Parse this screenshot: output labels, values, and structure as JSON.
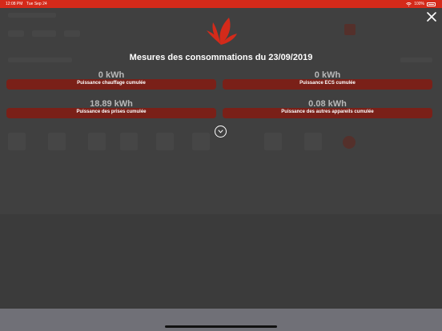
{
  "status_bar": {
    "time": "12:08 PM",
    "date": "Tue Sep 24",
    "battery": "100%"
  },
  "modal": {
    "title": "Mesures des consommations du 23/09/2019",
    "cards": [
      {
        "value": "0 kWh",
        "label": "Puissance chauffage cumulée"
      },
      {
        "value": "0 kWh",
        "label": "Puissance ECS cumulée"
      },
      {
        "value": "18.89 kWh",
        "label": "Puissance des prises cumulée"
      },
      {
        "value": "0.08 kWh",
        "label": "Puissance des autres appareils cumulée"
      }
    ]
  },
  "colors": {
    "status_bar": "#d42a1a",
    "card_bar": "#7a2018",
    "logo": "#d42a1a"
  },
  "icons": {
    "close": "close-icon",
    "logo": "leaf-logo-icon",
    "expand": "chevron-down-icon",
    "wifi": "wifi-icon",
    "battery": "battery-icon"
  }
}
